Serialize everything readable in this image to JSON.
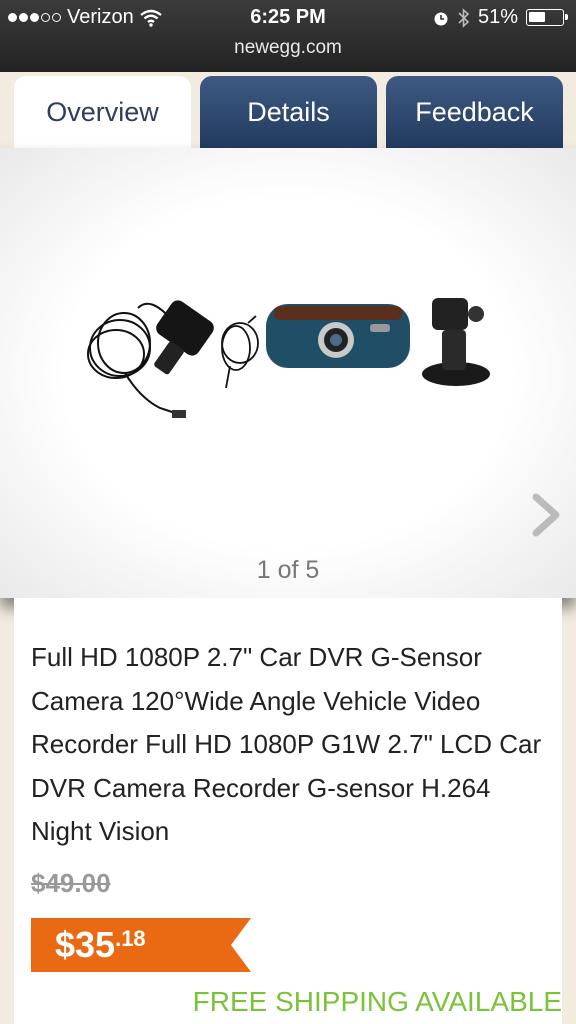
{
  "status_bar": {
    "carrier": "Verizon",
    "time": "6:25 PM",
    "battery_percent": "51%",
    "battery_level": 0.51,
    "url": "newegg.com"
  },
  "tabs": [
    {
      "label": "Overview",
      "active": true
    },
    {
      "label": "Details",
      "active": false
    },
    {
      "label": "Feedback",
      "active": false
    }
  ],
  "gallery": {
    "counter": "1 of 5",
    "next_icon": "chevron-right-icon"
  },
  "product": {
    "title": "Full HD 1080P 2.7\" Car DVR G-Sensor Camera 120°Wide Angle Vehicle Video Recorder Full HD 1080P G1W 2.7\" LCD Car DVR Camera Recorder G-sensor H.264 Night Vision",
    "old_price": "$49.00",
    "price_main": "$35",
    "price_cents": ".18",
    "shipping": "FREE SHIPPING AVAILABLE"
  },
  "colors": {
    "tab_active_text": "#2d3f5c",
    "tab_inactive_bg": "#2b4468",
    "price_flag": "#ea6a13",
    "shipping_green": "#7ac23a"
  }
}
